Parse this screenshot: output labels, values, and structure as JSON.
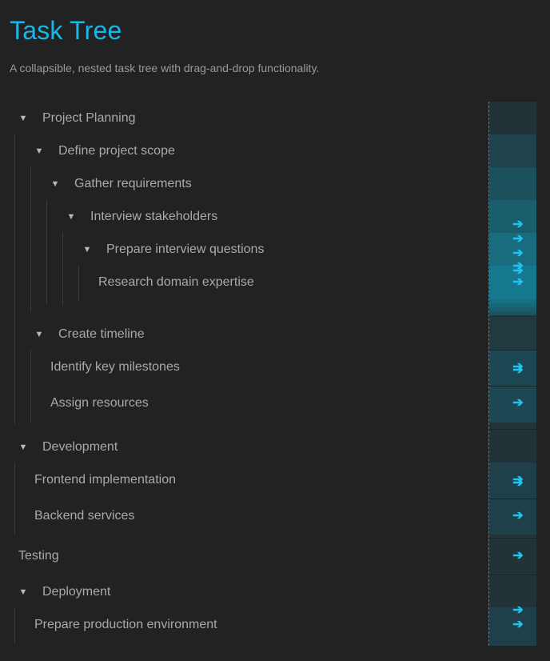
{
  "header": {
    "title": "Task Tree",
    "subtitle": "A collapsible, nested task tree with drag-and-drop functionality."
  },
  "icons": {
    "expanded": "▼",
    "drag_arrow": "➔"
  },
  "colors": {
    "accent": "#17b7e6",
    "background": "#222222",
    "text": "#aaaaaa",
    "rail": "#243338",
    "rail_active": "#16788e"
  },
  "tree": [
    {
      "label": "Project Planning",
      "expanded": true,
      "children": [
        {
          "label": "Define project scope",
          "expanded": true,
          "children": [
            {
              "label": "Gather requirements",
              "expanded": true,
              "children": [
                {
                  "label": "Interview stakeholders",
                  "expanded": true,
                  "children": [
                    {
                      "label": "Prepare interview questions",
                      "expanded": true,
                      "children": [
                        {
                          "label": "Research domain expertise"
                        }
                      ]
                    }
                  ]
                }
              ]
            }
          ]
        },
        {
          "label": "Create timeline",
          "expanded": true,
          "children": [
            {
              "label": "Identify key milestones"
            },
            {
              "label": "Assign resources"
            }
          ]
        }
      ]
    },
    {
      "label": "Development",
      "expanded": true,
      "children": [
        {
          "label": "Frontend implementation"
        },
        {
          "label": "Backend services"
        }
      ]
    },
    {
      "label": "Testing"
    },
    {
      "label": "Deployment",
      "expanded": true,
      "children": [
        {
          "label": "Prepare production environment"
        }
      ]
    }
  ]
}
